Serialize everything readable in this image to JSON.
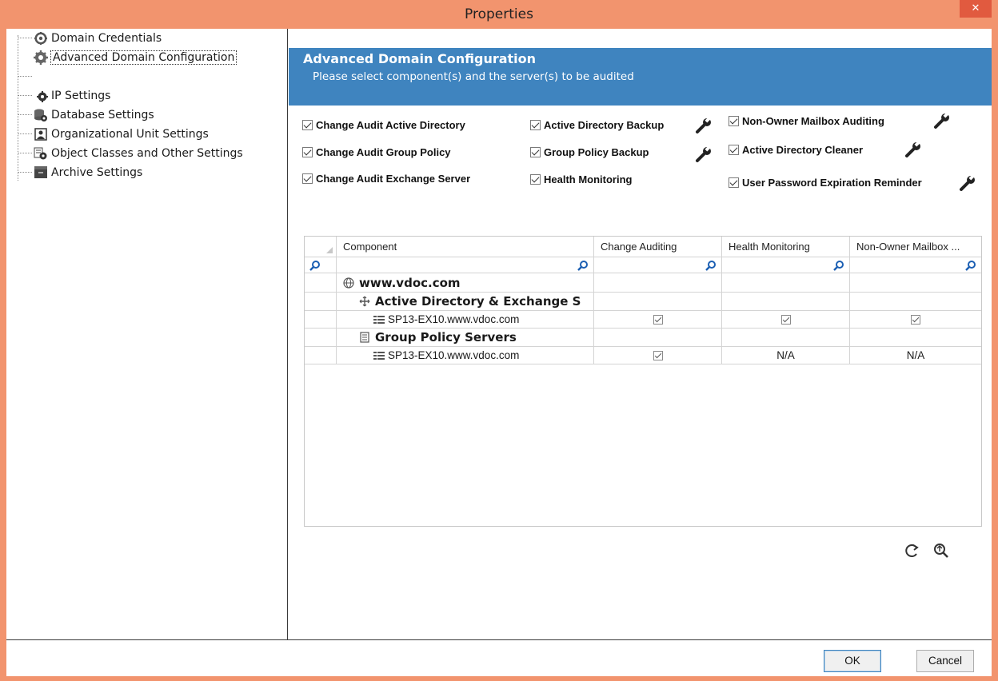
{
  "window": {
    "title": "Properties",
    "close_glyph": "✕"
  },
  "tree": {
    "items": [
      {
        "label": "Domain Credentials",
        "icon": "gear-globe-icon"
      },
      {
        "label": "Advanced Domain Configuration",
        "icon": "gears-icon",
        "selected": true
      },
      {
        "label": "IP Settings",
        "icon": "gear-small-icon"
      },
      {
        "label": "Database Settings",
        "icon": "database-gear-icon"
      },
      {
        "label": "Organizational Unit Settings",
        "icon": "ou-icon"
      },
      {
        "label": "Object Classes and Other Settings",
        "icon": "object-gear-icon"
      },
      {
        "label": "Archive Settings",
        "icon": "archive-icon"
      }
    ]
  },
  "banner": {
    "title": "Advanced Domain Configuration",
    "subtitle": "Please select component(s) and the server(s) to be audited"
  },
  "components": [
    {
      "label": "Change Audit Active Directory",
      "checked": true
    },
    {
      "label": "Change Audit Group Policy",
      "checked": true
    },
    {
      "label": "Change Audit Exchange Server",
      "checked": true
    },
    {
      "label": "Active Directory Backup",
      "checked": true,
      "has_settings": true
    },
    {
      "label": "Group Policy Backup",
      "checked": true,
      "has_settings": true
    },
    {
      "label": "Health Monitoring",
      "checked": true
    },
    {
      "label": "Non-Owner Mailbox Auditing",
      "checked": true,
      "has_settings": true
    },
    {
      "label": "Active Directory Cleaner",
      "checked": true,
      "has_settings": true
    },
    {
      "label": "User Password Expiration Reminder",
      "checked": true,
      "has_settings": true
    }
  ],
  "grid": {
    "columns": [
      "Component",
      "Change Auditing",
      "Health Monitoring",
      "Non-Owner Mailbox ..."
    ],
    "rows": [
      {
        "label": "www.vdoc.com",
        "kind": "root",
        "icon": "globe-icon",
        "values": [
          "",
          "",
          ""
        ]
      },
      {
        "label": "Active Directory & Exchange S",
        "kind": "group",
        "icon": "ad-icon",
        "values": [
          "",
          "",
          ""
        ]
      },
      {
        "label": "SP13-EX10.www.vdoc.com",
        "kind": "server",
        "icon": "server-icon",
        "values": [
          "check",
          "check",
          "check"
        ]
      },
      {
        "label": "Group Policy Servers",
        "kind": "group",
        "icon": "gpo-icon",
        "values": [
          "",
          "",
          ""
        ]
      },
      {
        "label": "SP13-EX10.www.vdoc.com",
        "kind": "server",
        "icon": "server-icon",
        "values": [
          "check",
          "N/A",
          "N/A"
        ]
      }
    ]
  },
  "toolbar": {
    "refresh_icon": "refresh-icon",
    "find_icon": "zoom-search-icon"
  },
  "buttons": {
    "ok": "OK",
    "cancel": "Cancel"
  },
  "colors": {
    "title_bar": "#f2946e",
    "close": "#e15a3f",
    "banner": "#3f84bf"
  }
}
